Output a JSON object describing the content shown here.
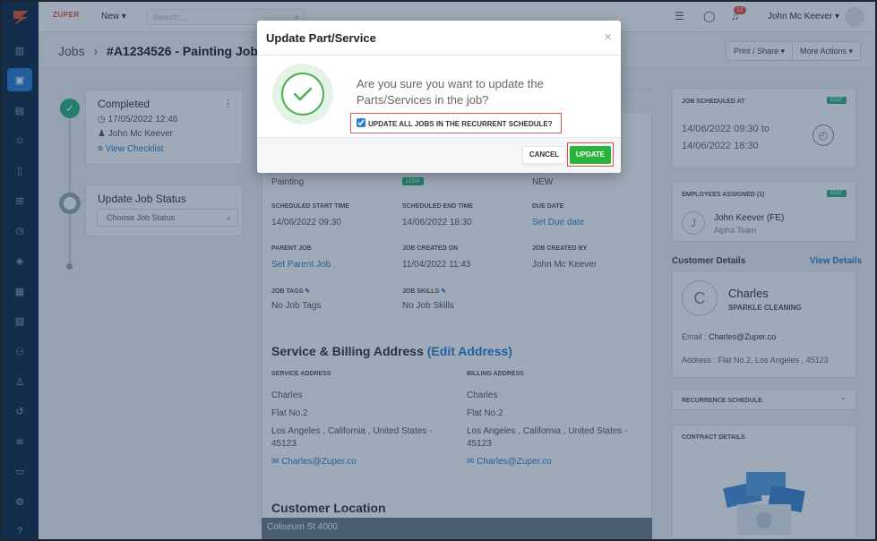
{
  "topbar": {
    "brand": "ZUPER",
    "new_label": "New ▾",
    "search_placeholder": "Search...",
    "notification_count": "12",
    "user_name": "John Mc Keever ▾"
  },
  "breadcrumb": {
    "root": "Jobs",
    "separator": "›",
    "current": "#A1234526 - Painting Job"
  },
  "header_actions": {
    "print_share": "Print / Share ▾",
    "more_actions": "More Actions ▾"
  },
  "timeline": {
    "completed_title": "Completed",
    "completed_date": "17/05/2022 12:46",
    "completed_by": "John Mc Keever",
    "view_checklist": "View Checklist",
    "update_status_title": "Update Job Status",
    "status_select": "Choose Job Status"
  },
  "job_details": {
    "category": "Painting",
    "priority": "LOW",
    "status": "NEW",
    "scheduled_start_label": "SCHEDULED START TIME",
    "scheduled_start": "14/06/2022 09:30",
    "scheduled_end_label": "SCHEDULED END TIME",
    "scheduled_end": "14/06/2022 18:30",
    "due_date_label": "DUE DATE",
    "due_date": "Set Due date",
    "parent_job_label": "PARENT JOB",
    "parent_job": "Set Parent Job",
    "created_on_label": "JOB CREATED ON",
    "created_on": "11/04/2022 11:43",
    "created_by_label": "JOB CREATED BY",
    "created_by": "John Mc Keever",
    "tags_label": "JOB TAGS",
    "tags": "No Job Tags",
    "skills_label": "JOB SKILLS",
    "skills": "No Job Skills"
  },
  "address": {
    "title": "Service & Billing Address",
    "edit_link": "(Edit Address)",
    "service_label": "SERVICE ADDRESS",
    "billing_label": "BILLING ADDRESS",
    "name": "Charles",
    "line1": "Flat No.2",
    "line2": "Los Angeles , California , United States -",
    "zip": "45123",
    "email": "Charles@Zuper.co"
  },
  "customer_location": {
    "title": "Customer Location",
    "map_label": "Coliseum St 4000"
  },
  "right_panel": {
    "scheduled_at_label": "JOB SCHEDULED AT",
    "scheduled_from": "14/06/2022 09:30 to",
    "scheduled_to": "14/06/2022 18:30",
    "edit": "EDIT",
    "employees_label": "EMPLOYEES ASSIGNED (1)",
    "employee_initial": "J",
    "employee_name": "John Keever (FE)",
    "employee_team": "Alpha Team",
    "customer_details_title": "Customer Details",
    "view_details": "View Details",
    "customer_initial": "C",
    "customer_name": "Charles",
    "customer_company": "SPARKLE CLEANING",
    "customer_email_label": "Email :",
    "customer_email": "Charles@Zuper.co",
    "customer_address_label": "Address :",
    "customer_address": "Flat No.2, Los Angeles , 45123",
    "recurrence_label": "RECURRENCE SCHEDULE",
    "contract_label": "CONTRACT DETAILS"
  },
  "modal": {
    "title": "Update Part/Service",
    "close": "×",
    "message": "Are you sure you want to update the Parts/Services in the job?",
    "checkbox_label": "UPDATE ALL JOBS IN THE RECURRENT SCHEDULE?",
    "checkbox_checked": true,
    "cancel_label": "CANCEL",
    "update_label": "UPDATE"
  },
  "colors": {
    "sidebar": "#0f2a47",
    "accent": "#2a7fd4",
    "success": "#28b33c",
    "highlight_box": "#d9534f"
  }
}
